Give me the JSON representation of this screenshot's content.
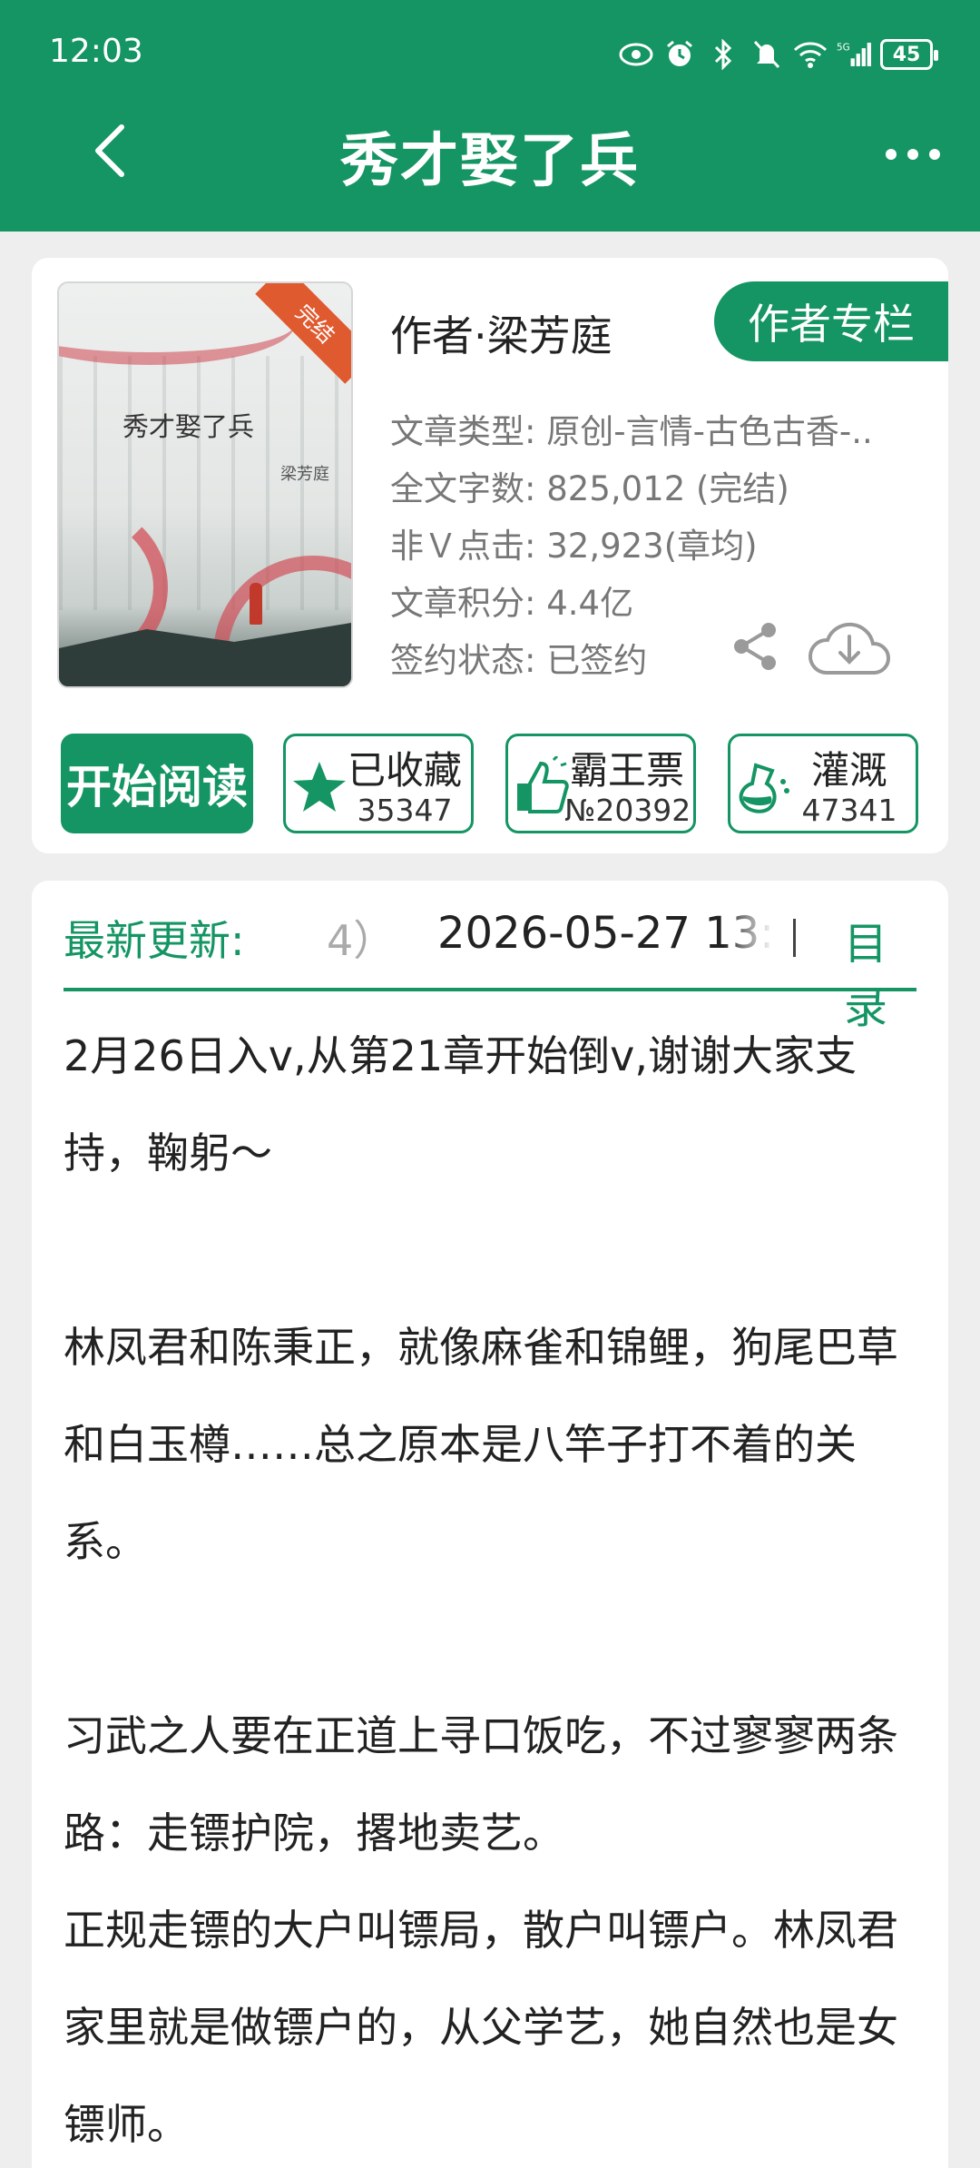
{
  "status_bar": {
    "time": "12:03",
    "battery": "45",
    "icons": [
      "eye-icon",
      "alarm-icon",
      "bluetooth-icon",
      "mute-icon",
      "wifi-icon",
      "signal-5g-icon",
      "battery-icon"
    ]
  },
  "nav": {
    "title": "秀才娶了兵"
  },
  "book": {
    "cover_title": "秀才娶了兵",
    "cover_author": "梁芳庭",
    "cover_badge": "完结",
    "author_line": "作者·梁芳庭",
    "author_column_button": "作者专栏",
    "info": [
      {
        "key": "文章类型:",
        "value": "原创-言情-古色古香-.."
      },
      {
        "key": "全文字数:",
        "value": "825,012 (完结)"
      },
      {
        "key": "非Ｖ点击:",
        "value": "32,923(章均)"
      },
      {
        "key": "文章积分:",
        "value": "4.4亿"
      },
      {
        "key": "签约状态:",
        "value": "已签约"
      }
    ]
  },
  "actions": {
    "read_button": "开始阅读",
    "favorite": {
      "label": "已收藏",
      "count": "35347"
    },
    "overlord_ticket": {
      "label": "霸王票",
      "count": "№20392"
    },
    "nutrient": {
      "label": "灌溉",
      "count": "47341"
    }
  },
  "update": {
    "label": "最新更新:",
    "chapter_fragment": "4）",
    "time": "2026-05-27 13:",
    "toc_link": "目录"
  },
  "intro": {
    "p1": "2月26日入v,从第21章开始倒v,谢谢大家支持，鞠躬～",
    "p2": "林凤君和陈秉正，就像麻雀和锦鲤，狗尾巴草和白玉樽……总之原本是八竿子打不着的关系。",
    "p3": "习武之人要在正道上寻口饭吃，不过寥寥两条路：走镖护院，撂地卖艺。",
    "p4": "正规走镖的大户叫镖局，散户叫镖户。林凤君家里就是做镖户的，从父学艺，她自然也是女镖师。"
  },
  "colors": {
    "brand_green": "#149563",
    "background": "#eeeeee",
    "card": "#ffffff"
  }
}
